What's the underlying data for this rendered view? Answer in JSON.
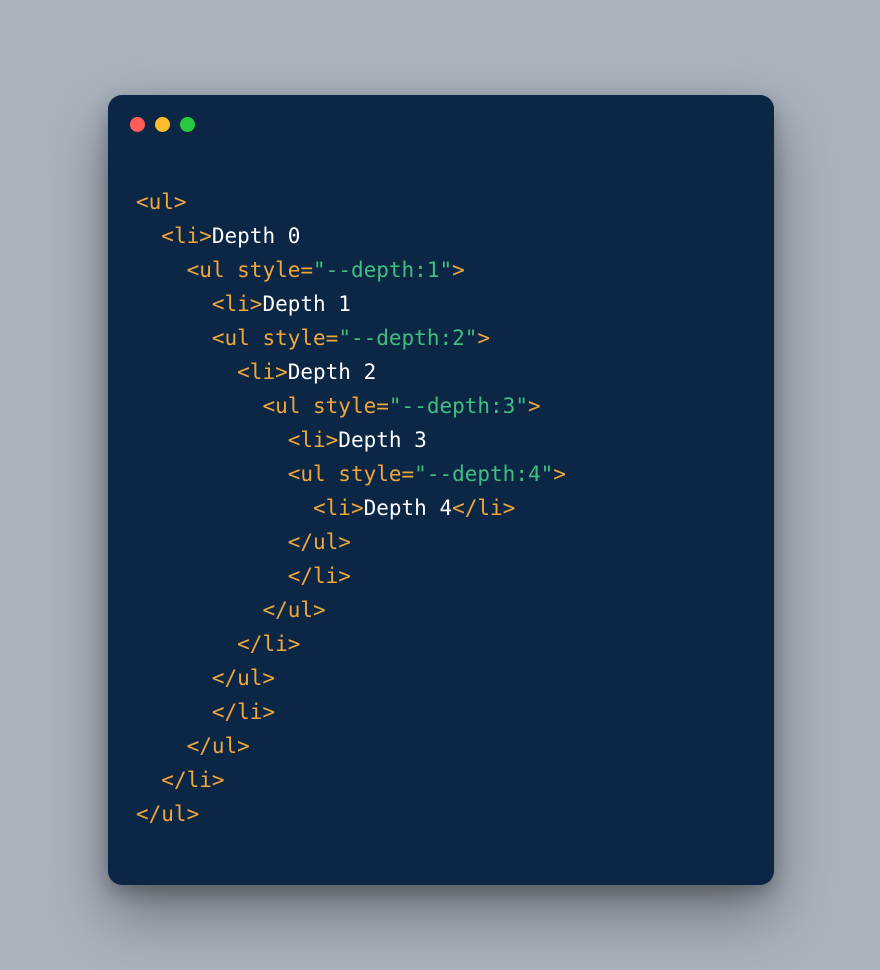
{
  "window": {
    "traffic": {
      "red": "#ff5f57",
      "yellow": "#febc2e",
      "green": "#28c840"
    }
  },
  "code": {
    "indent": "  ",
    "lines": [
      {
        "i": 0,
        "parts": [
          {
            "t": "tag",
            "v": "<ul>"
          }
        ]
      },
      {
        "i": 1,
        "parts": [
          {
            "t": "tag",
            "v": "<li>"
          },
          {
            "t": "text",
            "v": "Depth 0"
          }
        ]
      },
      {
        "i": 2,
        "parts": [
          {
            "t": "tag",
            "v": "<ul "
          },
          {
            "t": "attr",
            "v": "style"
          },
          {
            "t": "tag",
            "v": "="
          },
          {
            "t": "str",
            "v": "\"--depth:1\""
          },
          {
            "t": "tag",
            "v": ">"
          }
        ]
      },
      {
        "i": 3,
        "parts": [
          {
            "t": "tag",
            "v": "<li>"
          },
          {
            "t": "text",
            "v": "Depth 1"
          }
        ]
      },
      {
        "i": 3,
        "parts": [
          {
            "t": "tag",
            "v": "<ul "
          },
          {
            "t": "attr",
            "v": "style"
          },
          {
            "t": "tag",
            "v": "="
          },
          {
            "t": "str",
            "v": "\"--depth:2\""
          },
          {
            "t": "tag",
            "v": ">"
          }
        ]
      },
      {
        "i": 4,
        "parts": [
          {
            "t": "tag",
            "v": "<li>"
          },
          {
            "t": "text",
            "v": "Depth 2"
          }
        ]
      },
      {
        "i": 5,
        "parts": [
          {
            "t": "tag",
            "v": "<ul "
          },
          {
            "t": "attr",
            "v": "style"
          },
          {
            "t": "tag",
            "v": "="
          },
          {
            "t": "str",
            "v": "\"--depth:3\""
          },
          {
            "t": "tag",
            "v": ">"
          }
        ]
      },
      {
        "i": 6,
        "parts": [
          {
            "t": "tag",
            "v": "<li>"
          },
          {
            "t": "text",
            "v": "Depth 3"
          }
        ]
      },
      {
        "i": 6,
        "parts": [
          {
            "t": "tag",
            "v": "<ul "
          },
          {
            "t": "attr",
            "v": "style"
          },
          {
            "t": "tag",
            "v": "="
          },
          {
            "t": "str",
            "v": "\"--depth:4\""
          },
          {
            "t": "tag",
            "v": ">"
          }
        ]
      },
      {
        "i": 7,
        "parts": [
          {
            "t": "tag",
            "v": "<li>"
          },
          {
            "t": "text",
            "v": "Depth 4"
          },
          {
            "t": "tag",
            "v": "</li>"
          }
        ]
      },
      {
        "i": 6,
        "parts": [
          {
            "t": "tag",
            "v": "</ul>"
          }
        ]
      },
      {
        "i": 6,
        "parts": [
          {
            "t": "tag",
            "v": "</li>"
          }
        ]
      },
      {
        "i": 5,
        "parts": [
          {
            "t": "tag",
            "v": "</ul>"
          }
        ]
      },
      {
        "i": 4,
        "parts": [
          {
            "t": "tag",
            "v": "</li>"
          }
        ]
      },
      {
        "i": 3,
        "parts": [
          {
            "t": "tag",
            "v": "</ul>"
          }
        ]
      },
      {
        "i": 3,
        "parts": [
          {
            "t": "tag",
            "v": "</li>"
          }
        ]
      },
      {
        "i": 2,
        "parts": [
          {
            "t": "tag",
            "v": "</ul>"
          }
        ]
      },
      {
        "i": 1,
        "parts": [
          {
            "t": "tag",
            "v": "</li>"
          }
        ]
      },
      {
        "i": 0,
        "parts": [
          {
            "t": "tag",
            "v": "</ul>"
          }
        ]
      }
    ]
  }
}
